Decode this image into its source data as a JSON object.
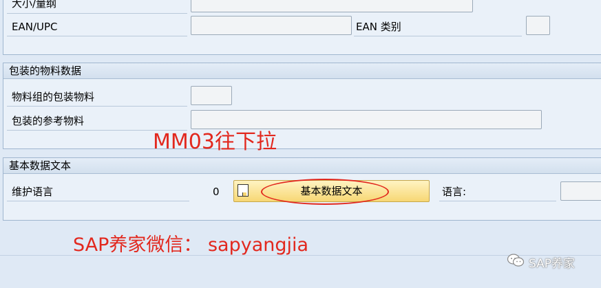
{
  "top_section": {
    "size_dims_label": "大小/量纲",
    "ean_upc_label": "EAN/UPC",
    "ean_category_label": "EAN 类别"
  },
  "packaging_section": {
    "title": "包装的物料数据",
    "material_group_label": "物料组的包装物料",
    "reference_material_label": "包装的参考物料"
  },
  "basic_text_section": {
    "title": "基本数据文本",
    "maintain_language_label": "维护语言",
    "count": "0",
    "button_label": "基本数据文本",
    "language_label": "语言:"
  },
  "annotations": {
    "mm03_note": "MM03往下拉",
    "wechat_note": "SAP养家微信： sapyangjia",
    "watermark": "SAP养家"
  },
  "colors": {
    "annotation_red": "#e2281e",
    "button_yellow": "#f7d774",
    "panel_bg": "#eaf1f9"
  }
}
